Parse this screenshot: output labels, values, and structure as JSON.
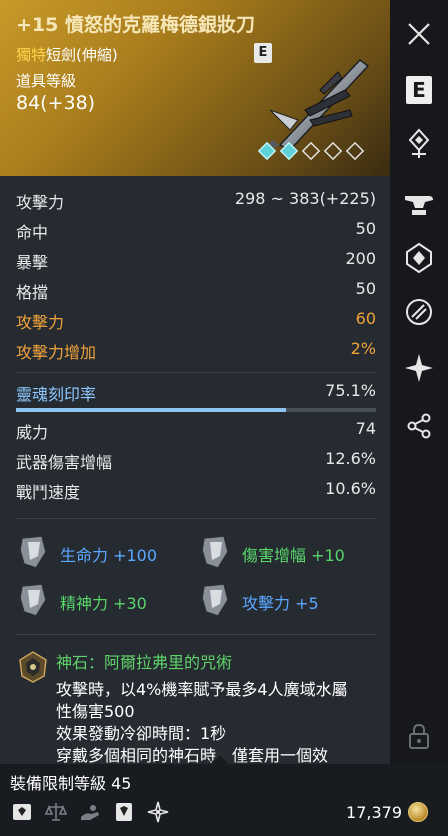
{
  "item": {
    "name": "+15 憤怒的克羅梅德銀妝刀",
    "grade_prefix": "獨特",
    "type": "短劍(伸縮)",
    "badge": "E",
    "level_label": "道具等級",
    "level_value": "84(+38)",
    "socket_filled": 2,
    "socket_total": 5
  },
  "stats": [
    {
      "label": "攻擊力",
      "value": "298 ~ 383(+225)",
      "color": "#e8e8e8"
    },
    {
      "label": "命中",
      "value": "50",
      "color": "#e8e8e8"
    },
    {
      "label": "暴擊",
      "value": "200",
      "color": "#e8e8e8"
    },
    {
      "label": "格擋",
      "value": "50",
      "color": "#e8e8e8"
    },
    {
      "label": "攻擊力",
      "value": "60",
      "color": "#f0a33a"
    },
    {
      "label": "攻擊力增加",
      "value": "2%",
      "color": "#f0a33a"
    }
  ],
  "soul": {
    "label": "靈魂刻印率",
    "value": "75.1%",
    "fill_fraction": 0.751
  },
  "stats2": [
    {
      "label": "威力",
      "value": "74"
    },
    {
      "label": "武器傷害增幅",
      "value": "12.6%"
    },
    {
      "label": "戰鬥速度",
      "value": "10.6%"
    }
  ],
  "attributes": [
    {
      "text": "生命力 +100",
      "color": "#5aa8ff"
    },
    {
      "text": "傷害增幅 +10",
      "color": "#58d66a"
    },
    {
      "text": "精神力 +30",
      "color": "#58d66a"
    },
    {
      "text": "攻擊力 +5",
      "color": "#5aa8ff"
    }
  ],
  "godstone": {
    "title": "神石：阿爾拉弗里的咒術",
    "lines": [
      "攻擊時，以4%機率賦予最多4人廣域水屬",
      "性傷害500",
      "效果發動冷卻時間：1秒",
      "穿戴多個相同的神石時，僅套用一個效"
    ]
  },
  "footer": {
    "requirement": "裝備限制等級 45",
    "price": "17,379",
    "icons": [
      "soul-bind-icon",
      "scale-icon",
      "hand-icon",
      "book-icon",
      "star-icon"
    ]
  },
  "sidebar": {
    "buttons": [
      "close-icon",
      "e-icon",
      "enchant-icon",
      "anvil-icon",
      "crystal-icon",
      "swap-icon",
      "sparkle-icon",
      "share-icon",
      "lock-icon"
    ]
  }
}
